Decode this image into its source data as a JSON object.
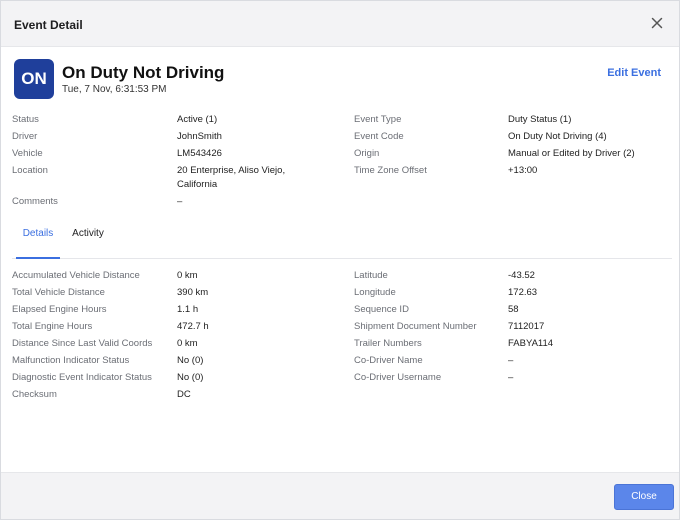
{
  "modal": {
    "title": "Event Detail"
  },
  "event": {
    "badge": "ON",
    "title": "On Duty Not Driving",
    "timestamp": "Tue, 7 Nov, 6:31:53 PM",
    "edit_label": "Edit Event"
  },
  "info_left": [
    {
      "label": "Status",
      "value": "Active (1)"
    },
    {
      "label": "Driver",
      "value": "JohnSmith"
    },
    {
      "label": "Vehicle",
      "value": "LM543426"
    },
    {
      "label": "Location",
      "value": "20 Enterprise, Aliso Viejo,",
      "value2": "California"
    },
    {
      "label": "Comments",
      "value": "–"
    }
  ],
  "info_right": [
    {
      "label": "Event Type",
      "value": "Duty Status (1)"
    },
    {
      "label": "Event Code",
      "value": "On Duty Not Driving (4)"
    },
    {
      "label": "Origin",
      "value": "Manual or Edited by Driver (2)"
    },
    {
      "label": "Time Zone Offset",
      "value": "+13:00"
    }
  ],
  "tabs": {
    "details": "Details",
    "activity": "Activity"
  },
  "details_left": [
    {
      "label": "Accumulated Vehicle Distance",
      "value": "0 km"
    },
    {
      "label": "Total Vehicle Distance",
      "value": "390 km"
    },
    {
      "label": "Elapsed Engine Hours",
      "value": "1.1 h"
    },
    {
      "label": "Total Engine Hours",
      "value": "472.7 h"
    },
    {
      "label": "Distance Since Last Valid Coords",
      "value": "0 km"
    },
    {
      "label": "Malfunction Indicator Status",
      "value": "No (0)"
    },
    {
      "label": "Diagnostic Event Indicator Status",
      "value": "No (0)"
    },
    {
      "label": "Checksum",
      "value": "DC"
    }
  ],
  "details_right": [
    {
      "label": "Latitude",
      "value": "-43.52"
    },
    {
      "label": "Longitude",
      "value": "172.63"
    },
    {
      "label": "Sequence ID",
      "value": "58"
    },
    {
      "label": "Shipment Document Number",
      "value": "7112017"
    },
    {
      "label": "Trailer Numbers",
      "value": "FABYA114"
    },
    {
      "label": "Co-Driver Name",
      "value": "–"
    },
    {
      "label": "Co-Driver Username",
      "value": "–"
    }
  ],
  "footer": {
    "close_label": "Close"
  }
}
